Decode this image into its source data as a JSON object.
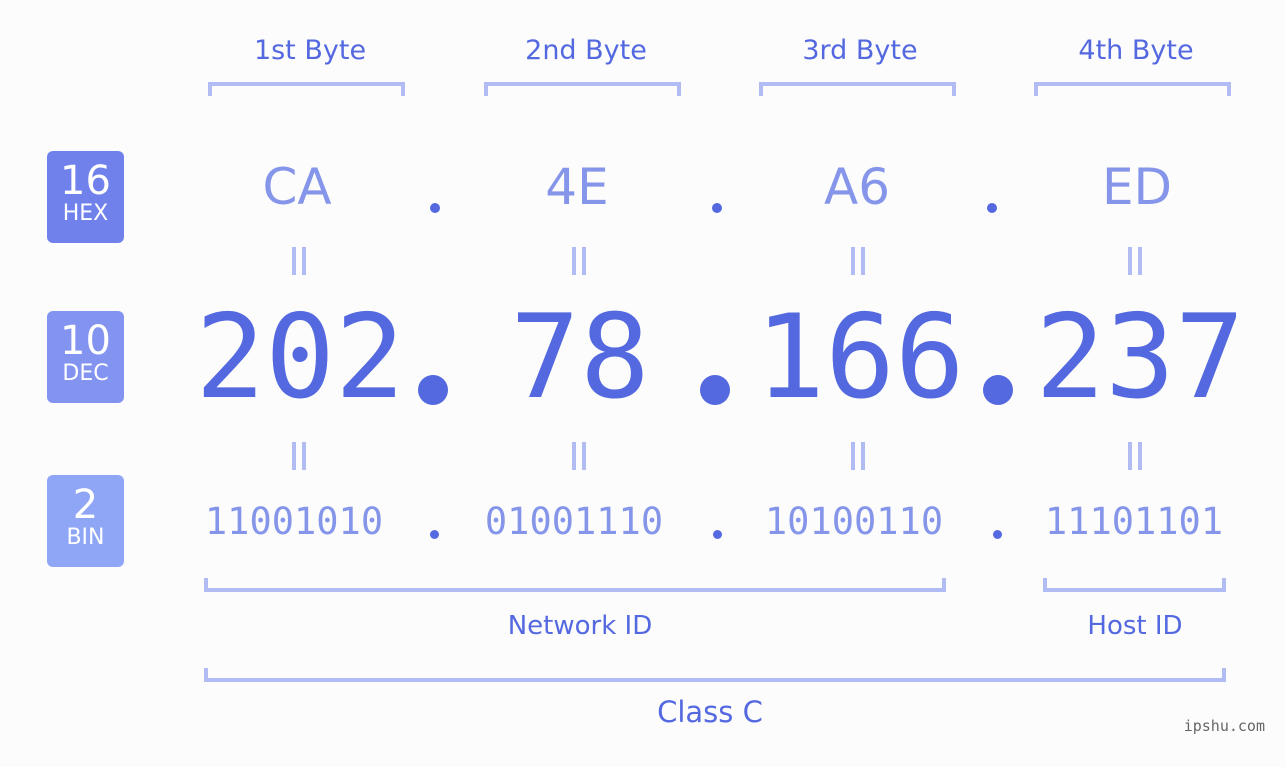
{
  "ip_address": "202.78.166.237",
  "byte_headers": [
    "1st Byte",
    "2nd Byte",
    "3rd Byte",
    "4th Byte"
  ],
  "badges": {
    "hex": {
      "base": "16",
      "label": "HEX",
      "color": "#7181ec"
    },
    "dec": {
      "base": "10",
      "label": "DEC",
      "color": "#8293f0"
    },
    "bin": {
      "base": "2",
      "label": "BIN",
      "color": "#8fa6f7"
    }
  },
  "hex_values": [
    "CA",
    "4E",
    "A6",
    "ED"
  ],
  "dec_values": [
    "202",
    "78",
    "166",
    "237"
  ],
  "bin_values": [
    "11001010",
    "01001110",
    "10100110",
    "11101101"
  ],
  "groups": {
    "network_id": "Network ID",
    "host_id": "Host ID",
    "ip_class": "Class C"
  },
  "watermark": "ipshu.com",
  "colors": {
    "accent": "#5468e0",
    "light_accent": "#8595ea",
    "bracket": "#b1bcf5"
  }
}
